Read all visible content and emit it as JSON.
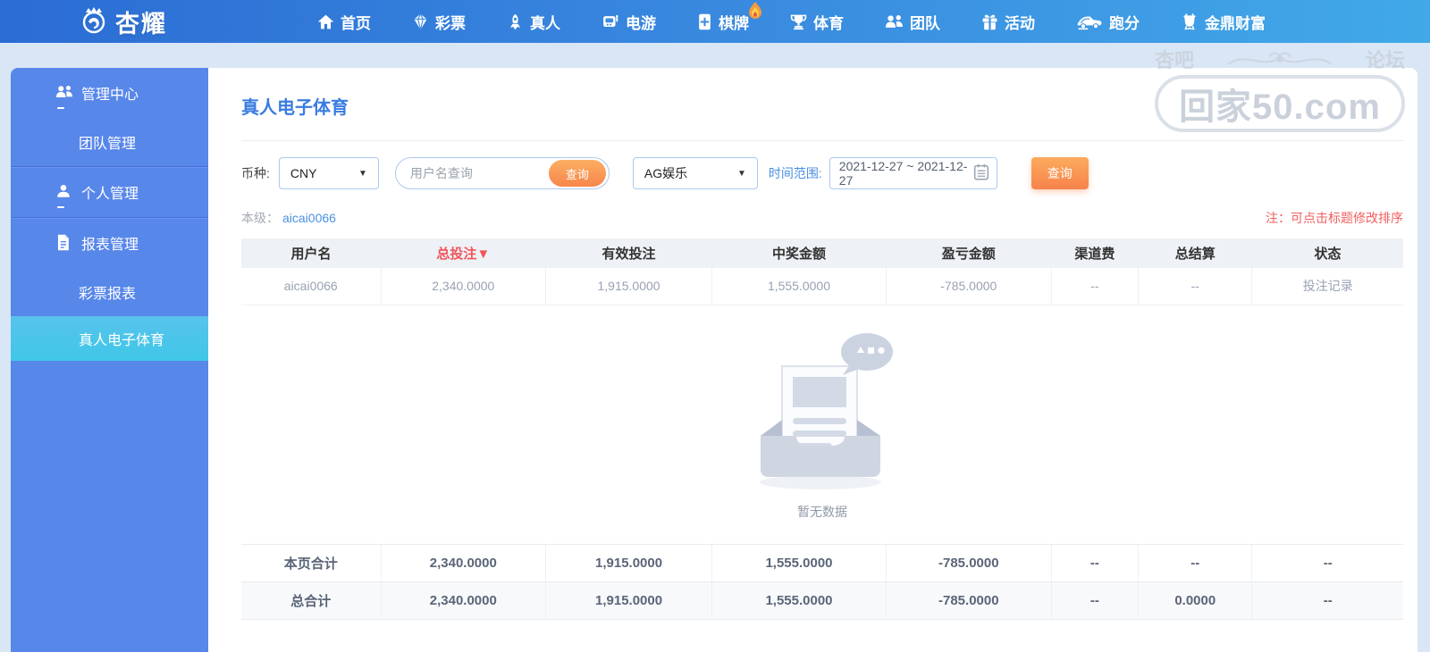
{
  "brand": {
    "name": "杏耀"
  },
  "nav": {
    "items": [
      {
        "label": "首页",
        "icon": "home-icon"
      },
      {
        "label": "彩票",
        "icon": "lottery-icon"
      },
      {
        "label": "真人",
        "icon": "live-icon"
      },
      {
        "label": "电游",
        "icon": "egame-icon"
      },
      {
        "label": "棋牌",
        "icon": "board-games-icon",
        "badge": "flame-icon"
      },
      {
        "label": "体育",
        "icon": "sports-icon"
      },
      {
        "label": "团队",
        "icon": "team-icon"
      },
      {
        "label": "活动",
        "icon": "activity-icon"
      },
      {
        "label": "跑分",
        "icon": "paofen-icon"
      },
      {
        "label": "金鼎财富",
        "icon": "wealth-icon"
      }
    ]
  },
  "sidebar": {
    "items": [
      {
        "label": "管理中心",
        "type": "group",
        "icon": "team-icon"
      },
      {
        "label": "团队管理",
        "type": "sub"
      },
      {
        "label": "个人管理",
        "type": "group",
        "icon": "user-icon"
      },
      {
        "label": "报表管理",
        "type": "group",
        "icon": "report-icon"
      },
      {
        "label": "彩票报表",
        "type": "sub"
      },
      {
        "label": "真人电子体育",
        "type": "sub",
        "active": true
      }
    ]
  },
  "page": {
    "title": "真人电子体育",
    "level_label": "本级：",
    "level_value": "aicai0066",
    "sort_note": "注：可点击标题修改排序"
  },
  "filters": {
    "currency_label": "币种:",
    "currency_value": "CNY",
    "username_placeholder": "用户名查询",
    "inline_search_label": "查询",
    "platform_value": "AG娱乐",
    "date_label": "时间范围:",
    "date_value": "2021-12-27 ~ 2021-12-27",
    "search_label": "查询"
  },
  "table": {
    "headers": [
      "用户名",
      "总投注▼",
      "有效投注",
      "中奖金额",
      "盈亏金额",
      "渠道费",
      "总结算",
      "状态"
    ],
    "rows": [
      {
        "cells": [
          "aicai0066",
          "2,340.0000",
          "1,915.0000",
          "1,555.0000",
          "-785.0000",
          "--",
          "--",
          "投注记录"
        ]
      }
    ],
    "empty_text": "暂无数据",
    "page_total": {
      "cells": [
        "本页合计",
        "2,340.0000",
        "1,915.0000",
        "1,555.0000",
        "-785.0000",
        "--",
        "--",
        "--"
      ]
    },
    "grand_total": {
      "cells": [
        "总合计",
        "2,340.0000",
        "1,915.0000",
        "1,555.0000",
        "-785.0000",
        "--",
        "0.0000",
        "--"
      ]
    }
  },
  "watermark": {
    "left_text": "杏吧",
    "right_text": "论坛",
    "box_text": "回家50.com"
  },
  "colors": {
    "nav_gradient_start": "#2b6cd4",
    "nav_gradient_end": "#41a9e8",
    "sidebar": "#5887ea",
    "sidebar_active": "#45c5ea",
    "accent_orange": "#f7864c",
    "title_blue": "#3a7ce0",
    "link_blue": "#4a90e2",
    "alert_red": "#f0565a",
    "loss_red": "#e04343",
    "page_bg": "#d9e6f5"
  }
}
